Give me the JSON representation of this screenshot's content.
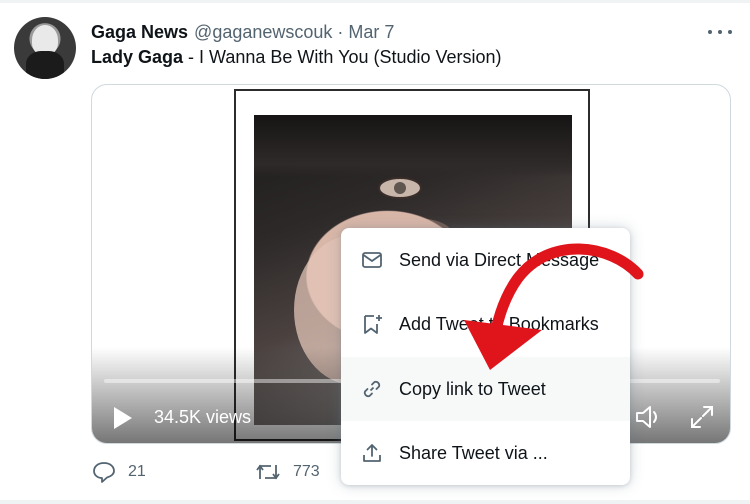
{
  "tweet": {
    "display_name": "Gaga News",
    "handle": "@gaganewscouk",
    "separator": "·",
    "date": "Mar 7",
    "text_bold": "Lady Gaga",
    "text_rest": " - I Wanna Be With You (Studio Version)"
  },
  "video": {
    "views": "34.5K views",
    "progress": 0.0
  },
  "actions": {
    "reply_count": "21",
    "retweet_count": "773"
  },
  "menu": {
    "items": [
      {
        "label": "Send via Direct Message",
        "icon": "envelope-icon"
      },
      {
        "label": "Add Tweet to Bookmarks",
        "icon": "bookmark-add-icon"
      },
      {
        "label": "Copy link to Tweet",
        "icon": "link-icon"
      },
      {
        "label": "Share Tweet via ...",
        "icon": "share-icon"
      }
    ]
  },
  "colors": {
    "text_primary": "#0f1419",
    "text_secondary": "#536471",
    "annotation_arrow": "#e0151b",
    "menu_hover": "#f7f9f9"
  }
}
